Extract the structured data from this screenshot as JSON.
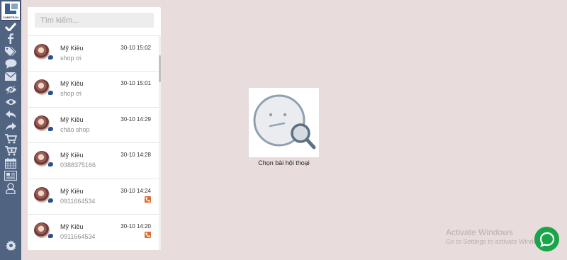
{
  "brand": {
    "logo_text": "CUBETECH"
  },
  "sidebar": {
    "icons": [
      {
        "name": "check-icon"
      },
      {
        "name": "facebook-icon"
      },
      {
        "name": "tags-icon"
      },
      {
        "name": "comment-icon"
      },
      {
        "name": "envelope-icon"
      },
      {
        "name": "eye-slash-icon"
      },
      {
        "name": "eye-icon"
      },
      {
        "name": "reply-icon"
      },
      {
        "name": "share-icon"
      },
      {
        "name": "cart-icon"
      },
      {
        "name": "cart-plus-icon"
      },
      {
        "name": "calendar-icon"
      },
      {
        "name": "newspaper-icon"
      },
      {
        "name": "user-icon"
      }
    ],
    "settings_icon": "gear-icon"
  },
  "search": {
    "placeholder": "Tìm kiếm..."
  },
  "conversations": [
    {
      "name": "Mỹ Kiều",
      "time": "30-10 15:02",
      "snippet": "shop ơi",
      "phone": false
    },
    {
      "name": "Mỹ Kiều",
      "time": "30-10 15:01",
      "snippet": "shop ơi",
      "phone": false
    },
    {
      "name": "Mỹ Kiều",
      "time": "30-10 14:29",
      "snippet": "chào shop",
      "phone": false
    },
    {
      "name": "Mỹ Kiều",
      "time": "30-10 14:28",
      "snippet": "0388375166",
      "phone": false
    },
    {
      "name": "Mỹ Kiều",
      "time": "30-10 14:24",
      "snippet": "0911664534",
      "phone": true
    },
    {
      "name": "Mỹ Kiều",
      "time": "30-10 14:20",
      "snippet": "0911664534",
      "phone": true
    }
  ],
  "empty_state": {
    "caption": "Chọn bài hội thoại"
  },
  "watermark": {
    "title": "Activate Windows",
    "subtitle": "Go to Settings to activate Windows."
  },
  "colors": {
    "rail": "#506482",
    "background": "#e8dcdc",
    "accent_green": "#1aa54b",
    "phone_orange": "#e36a2e",
    "message_blue": "#2b4f8f"
  }
}
